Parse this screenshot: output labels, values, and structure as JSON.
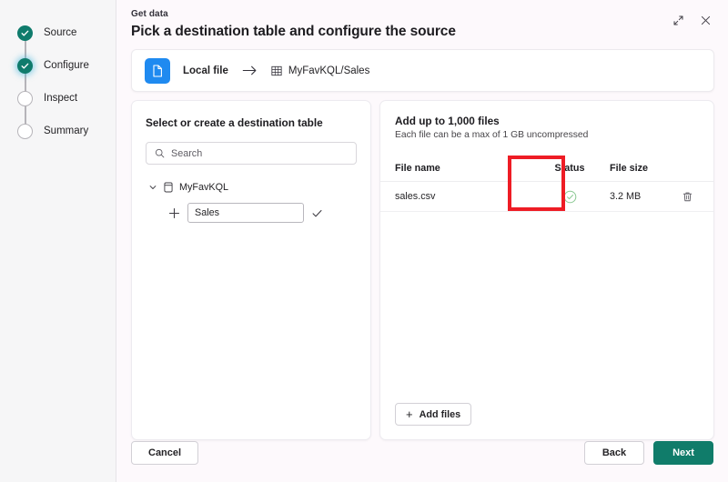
{
  "stepper": {
    "steps": [
      {
        "label": "Source",
        "state": "done"
      },
      {
        "label": "Configure",
        "state": "current"
      },
      {
        "label": "Inspect",
        "state": "todo"
      },
      {
        "label": "Summary",
        "state": "todo"
      }
    ]
  },
  "header": {
    "eyebrow": "Get data",
    "title": "Pick a destination table and configure the source",
    "expand_icon": "expand-icon",
    "close_icon": "close-icon"
  },
  "source_bar": {
    "file_icon": "document-icon",
    "source_label": "Local file",
    "arrow_icon": "arrow-right-icon",
    "destination_icon": "table-icon",
    "destination_label": "MyFavKQL/Sales"
  },
  "left_panel": {
    "title": "Select or create a destination table",
    "search": {
      "icon": "search-icon",
      "placeholder": "Search",
      "value": ""
    },
    "tree": {
      "chevron_icon": "chevron-down-icon",
      "database_icon": "database-icon",
      "database_label": "MyFavKQL",
      "add_icon": "plus-icon",
      "table_input_value": "Sales",
      "confirm_icon": "checkmark-icon"
    }
  },
  "right_panel": {
    "title": "Add up to 1,000 files",
    "subtitle": "Each file can be a max of 1 GB uncompressed",
    "table": {
      "columns": [
        "File name",
        "Status",
        "File size"
      ],
      "rows": [
        {
          "file_name": "sales.csv",
          "status_icon": "status-success-icon",
          "file_size": "3.2 MB",
          "delete_icon": "trash-icon"
        }
      ]
    },
    "add_files_button": {
      "plus": "+",
      "label": "Add files"
    }
  },
  "footer": {
    "cancel_label": "Cancel",
    "back_label": "Back",
    "next_label": "Next"
  },
  "annotation": {
    "highlight_target": "Status",
    "color": "#ee1c25"
  },
  "colors": {
    "accent_green": "#107c6a",
    "step_done": "#0f7b6c",
    "file_icon_blue": "#1f8af0",
    "status_success": "#86c88a",
    "sidebar_bg": "#f6f6f7",
    "dialog_bg": "#fdf9fc"
  }
}
